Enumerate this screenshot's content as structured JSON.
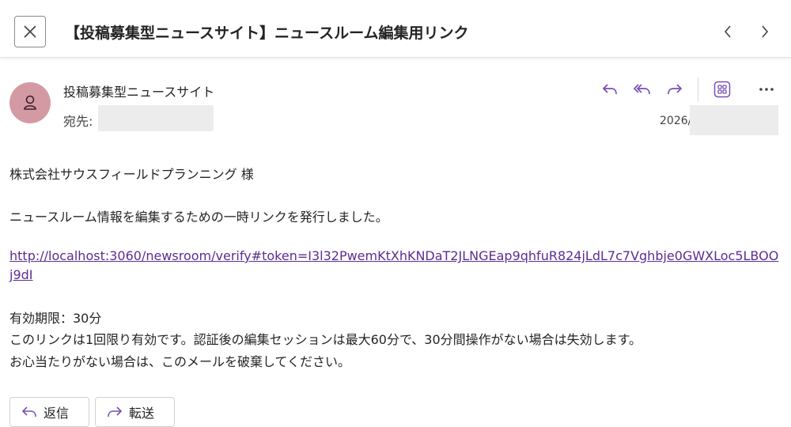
{
  "header": {
    "subject": "【投稿募集型ニュースサイト】ニュースルーム編集用リンク"
  },
  "message": {
    "sender": "投稿募集型ニュースサイト",
    "to_label": "宛先:",
    "date": "2026/"
  },
  "body": {
    "salutation": "株式会社サウスフィールドプランニング 様",
    "intro": "ニュースルーム情報を編集するための一時リンクを発行しました。",
    "link": "http://localhost:3060/newsroom/verify#token=I3l32PwemKtXhKNDaT2JLNGEap9qhfuR824jLdL7c7Vghbje0GWXLoc5LBOOj9dI",
    "expiry": "有効期限：30分",
    "note": "このリンクは1回限り有効です。認証後の編集セッションは最大60分で、30分間操作がない場合は失効します。",
    "closing": "お心当たりがない場合は、このメールを破棄してください。"
  },
  "buttons": {
    "reply": "返信",
    "forward": "転送"
  },
  "icons": {
    "close": "close-icon",
    "prev": "chevron-left-icon",
    "next": "chevron-right-icon",
    "reply": "reply-icon",
    "reply_all": "reply-all-icon",
    "forward": "forward-icon",
    "apps": "apps-icon",
    "more": "more-icon",
    "avatar": "person-icon"
  },
  "colors": {
    "accent": "#7a4fb5",
    "avatar_bg": "#d49aa3",
    "link": "#5b2d91"
  }
}
